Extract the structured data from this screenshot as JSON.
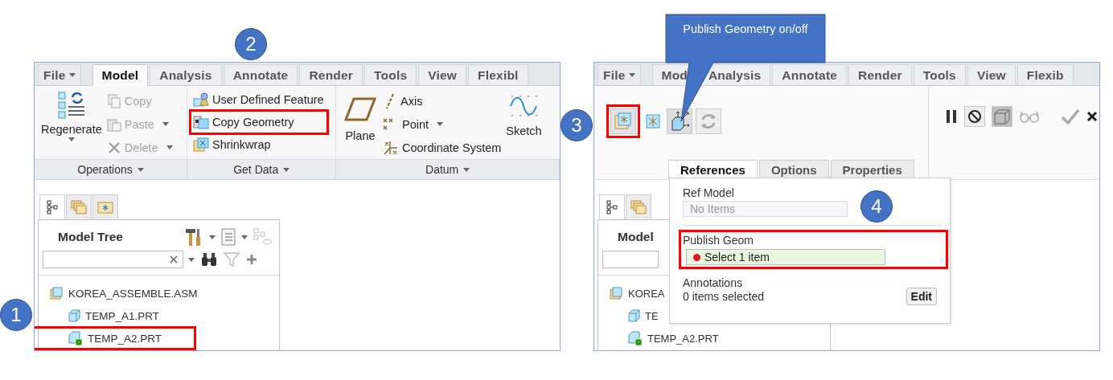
{
  "left": {
    "tabs": [
      {
        "label": "File",
        "selected": false,
        "dropdown": true
      },
      {
        "label": "Model",
        "selected": true,
        "dropdown": false
      },
      {
        "label": "Analysis",
        "selected": false,
        "dropdown": false
      },
      {
        "label": "Annotate",
        "selected": false,
        "dropdown": false
      },
      {
        "label": "Render",
        "selected": false,
        "dropdown": false
      },
      {
        "label": "Tools",
        "selected": false,
        "dropdown": false
      },
      {
        "label": "View",
        "selected": false,
        "dropdown": false
      },
      {
        "label": "Flexibl",
        "selected": false,
        "dropdown": false
      }
    ],
    "regenerate": "Regenerate",
    "operations": [
      {
        "label": "Copy",
        "disabled": true,
        "dropdown": false
      },
      {
        "label": "Paste",
        "disabled": true,
        "dropdown": true
      },
      {
        "label": "Delete",
        "disabled": true,
        "dropdown": true
      }
    ],
    "get_data": [
      {
        "label": "User Defined Feature",
        "highlighted": false
      },
      {
        "label": "Copy Geometry",
        "highlighted": true
      },
      {
        "label": "Shrinkwrap",
        "highlighted": false
      }
    ],
    "plane": "Plane",
    "datum": [
      {
        "label": "Axis",
        "dropdown": false
      },
      {
        "label": "Point",
        "dropdown": true
      },
      {
        "label": "Coordinate System",
        "dropdown": false
      }
    ],
    "sketch": "Sketch",
    "groups": [
      "Operations",
      "Get Data",
      "Datum"
    ],
    "tree_tabs": [
      {
        "selected": true
      },
      {
        "selected": false
      },
      {
        "selected": false
      }
    ],
    "tree_title": "Model Tree",
    "tree": [
      {
        "label": "KOREA_ASSEMBLE.ASM",
        "kind": "assembly",
        "highlighted": false,
        "children": [
          {
            "label": "TEMP_A1.PRT",
            "kind": "part",
            "highlighted": false
          },
          {
            "label": "TEMP_A2.PRT",
            "kind": "active_part",
            "highlighted": true
          }
        ]
      }
    ]
  },
  "right": {
    "tabs": [
      {
        "label": "File",
        "selected": false,
        "dropdown": true
      },
      {
        "label": "Mod",
        "selected": false,
        "dropdown": false
      },
      {
        "label": "Analysis",
        "selected": false,
        "dropdown": false
      },
      {
        "label": "Annotate",
        "selected": false,
        "dropdown": false
      },
      {
        "label": "Render",
        "selected": false,
        "dropdown": false
      },
      {
        "label": "Tools",
        "selected": false,
        "dropdown": false
      },
      {
        "label": "View",
        "selected": false,
        "dropdown": false
      },
      {
        "label": "Flexib",
        "selected": false,
        "dropdown": false
      }
    ],
    "publish_button_highlighted": true,
    "dashboard_tabs": [
      {
        "label": "References",
        "selected": true
      },
      {
        "label": "Options",
        "selected": false
      },
      {
        "label": "Properties",
        "selected": false
      }
    ],
    "tree_tabs": [
      {
        "selected": true
      },
      {
        "selected": false
      }
    ],
    "tree_title": "Model",
    "tree": [
      {
        "label": "KOREA",
        "kind": "assembly",
        "highlighted": false,
        "children": [
          {
            "label": "TE",
            "kind": "part",
            "highlighted": false
          },
          {
            "label": "TEMP_A2.PRT",
            "kind": "active_part",
            "highlighted": false
          }
        ]
      }
    ],
    "references": {
      "ref_model_label": "Ref Model",
      "ref_model_placeholder": "No Items",
      "publish_label": "Publish Geom",
      "publish_value": "Select 1 item",
      "publish_highlighted": true,
      "annotations_label": "Annotations",
      "annotations_value": "0 items selected",
      "edit_button": "Edit"
    }
  },
  "callouts": {
    "markers": [
      "1",
      "2",
      "3",
      "4"
    ],
    "note": "Publish Geometry on/off"
  }
}
